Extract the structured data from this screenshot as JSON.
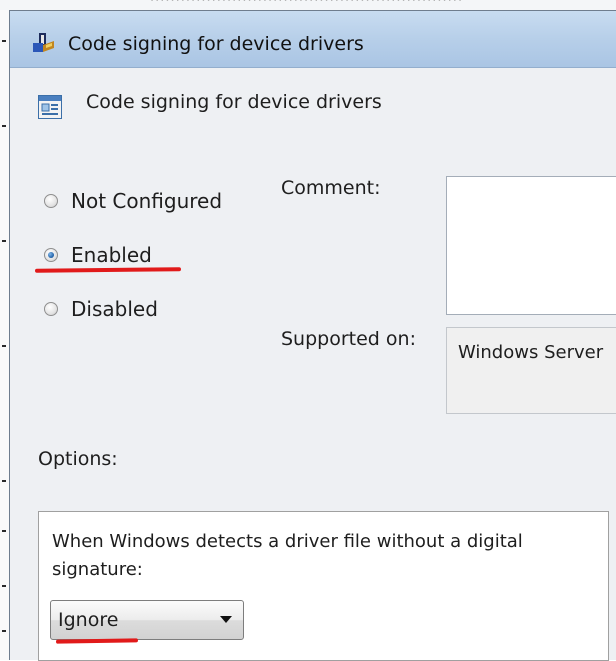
{
  "window": {
    "title": "Code signing for device drivers",
    "icon": "policy-app-icon"
  },
  "header": {
    "title": "Code signing for device drivers",
    "icon": "policy-setting-icon"
  },
  "state": {
    "options": [
      {
        "label": "Not Configured",
        "selected": false
      },
      {
        "label": "Enabled",
        "selected": true
      },
      {
        "label": "Disabled",
        "selected": false
      }
    ]
  },
  "comment": {
    "label": "Comment:",
    "value": ""
  },
  "supported": {
    "label": "Supported on:",
    "value": "Windows Server"
  },
  "options_section": {
    "label": "Options:",
    "description": "When Windows detects a driver file without a digital signature:",
    "select_value": "Ignore"
  },
  "annotations": {
    "underline_color": "#e11a1a"
  },
  "colors": {
    "titlebar": "#b7cfe9",
    "dialog_bg": "#eef0f3",
    "radio_selected": "#1e5fa6"
  }
}
